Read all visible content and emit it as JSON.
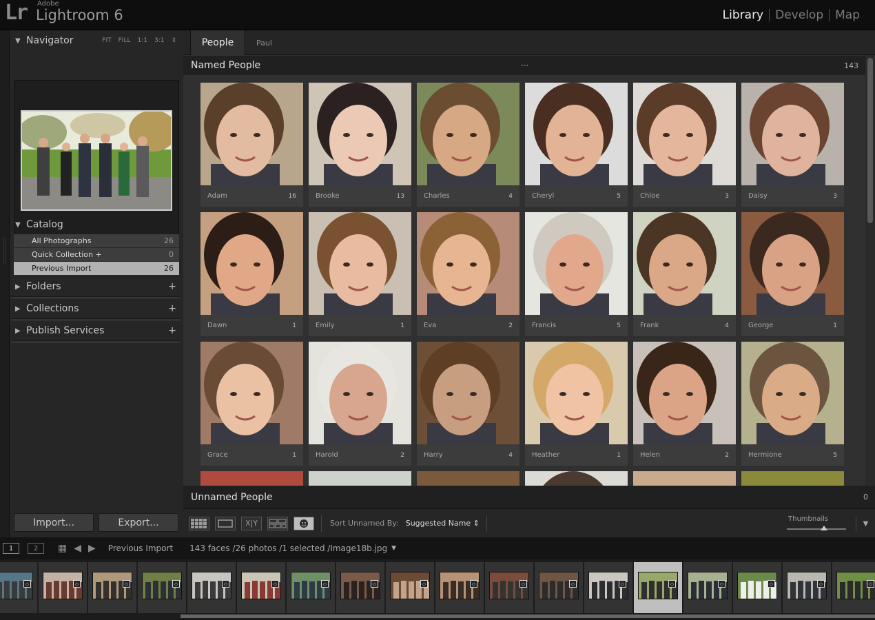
{
  "app": {
    "adobe": "Adobe",
    "name": "Lightroom 6",
    "logo": "Lr"
  },
  "modules": [
    {
      "label": "Library",
      "active": true
    },
    {
      "label": "Develop",
      "active": false
    },
    {
      "label": "Map",
      "active": false
    }
  ],
  "navigator": {
    "title": "Navigator",
    "options": [
      "FIT",
      "FILL",
      "1:1",
      "3:1"
    ],
    "options_caret": "⇕"
  },
  "catalog": {
    "title": "Catalog",
    "items": [
      {
        "label": "All Photographs",
        "count": "26"
      },
      {
        "label": "Quick Collection +",
        "count": "0"
      },
      {
        "label": "Previous Import",
        "count": "26"
      }
    ]
  },
  "panels": [
    {
      "label": "Folders"
    },
    {
      "label": "Collections"
    },
    {
      "label": "Publish Services"
    }
  ],
  "buttons": {
    "import": "Import...",
    "export": "Export..."
  },
  "tabs": {
    "people": "People",
    "paul": "Paul"
  },
  "named": {
    "title": "Named People",
    "dots": "···",
    "count": "143"
  },
  "unnamed": {
    "title": "Unnamed People",
    "count": "0"
  },
  "faces": [
    {
      "name": "Adam",
      "count": "16",
      "bg": "#b7a68c",
      "skin": "#e3bba0",
      "hair": "#5a3f2a"
    },
    {
      "name": "Brooke",
      "count": "13",
      "bg": "#cfc5b6",
      "skin": "#ecc9b4",
      "hair": "#2a2120"
    },
    {
      "name": "Charles",
      "count": "4",
      "bg": "#7c8a5a",
      "skin": "#d6a883",
      "hair": "#6b4d31"
    },
    {
      "name": "Cheryl",
      "count": "5",
      "bg": "#dcdcdc",
      "skin": "#e2b394",
      "hair": "#4a2e22"
    },
    {
      "name": "Chloe",
      "count": "3",
      "bg": "#dedbd6",
      "skin": "#e4b79c",
      "hair": "#5a3c28"
    },
    {
      "name": "Daisy",
      "count": "3",
      "bg": "#b9b2aa",
      "skin": "#e0b39e",
      "hair": "#6a4430"
    },
    {
      "name": "Dawn",
      "count": "1",
      "bg": "#c4a080",
      "skin": "#e0a887",
      "hair": "#2c1d17"
    },
    {
      "name": "Emily",
      "count": "1",
      "bg": "#c9c0b3",
      "skin": "#e9bca1",
      "hair": "#7a5232"
    },
    {
      "name": "Eva",
      "count": "2",
      "bg": "#b68b77",
      "skin": "#e8b592",
      "hair": "#8b6236"
    },
    {
      "name": "Francis",
      "count": "5",
      "bg": "#e6e6e0",
      "skin": "#e1a88c",
      "hair": "#cfc9c0"
    },
    {
      "name": "Frank",
      "count": "4",
      "bg": "#cfd3c2",
      "skin": "#dba887",
      "hair": "#4b3524"
    },
    {
      "name": "George",
      "count": "1",
      "bg": "#8a5b3f",
      "skin": "#d9a284",
      "hair": "#3b281e"
    },
    {
      "name": "Grace",
      "count": "1",
      "bg": "#9f7a66",
      "skin": "#ebc1a3",
      "hair": "#6a4b36"
    },
    {
      "name": "Harold",
      "count": "2",
      "bg": "#e5e3dd",
      "skin": "#d8a58e",
      "hair": "#e8e6e0"
    },
    {
      "name": "Harry",
      "count": "4",
      "bg": "#6d4f37",
      "skin": "#c79e80",
      "hair": "#5e3f25"
    },
    {
      "name": "Heather",
      "count": "1",
      "bg": "#d9c9ad",
      "skin": "#efc3a3",
      "hair": "#d3a868"
    },
    {
      "name": "Helen",
      "count": "2",
      "bg": "#c8c1b9",
      "skin": "#dba487",
      "hair": "#3a2619"
    },
    {
      "name": "Hermione",
      "count": "5",
      "bg": "#b5b18f",
      "skin": "#d9ac87",
      "hair": "#6b5540"
    },
    {
      "name": "",
      "count": "",
      "bg": "#b04a3e",
      "skin": "#d08c70",
      "hair": "#b04a3e"
    },
    {
      "name": "",
      "count": "",
      "bg": "#cdd2cc",
      "skin": "#e0b090",
      "hair": "#cdd2cc"
    },
    {
      "name": "",
      "count": "",
      "bg": "#7a5a3a",
      "skin": "#cc9a70",
      "hair": "#7a5a3a"
    },
    {
      "name": "",
      "count": "",
      "bg": "#dcdad4",
      "skin": "#d8a888",
      "hair": "#4a3a30"
    },
    {
      "name": "",
      "count": "",
      "bg": "#c9aa8a",
      "skin": "#d6a080",
      "hair": "#c9aa8a"
    },
    {
      "name": "",
      "count": "",
      "bg": "#8a8a3a",
      "skin": "#c9a070",
      "hair": "#8a8a3a"
    }
  ],
  "toolbar": {
    "sort_label": "Sort Unnamed By:",
    "sort_value": "Suggested Name ⇕",
    "thumbnails_label": "Thumbnails",
    "thumbnail_size": 0.63
  },
  "filmstrip_header": {
    "screen1": "1",
    "screen2": "2",
    "source": "Previous Import",
    "status": "143 faces /26 photos /1 selected /Image18b.jpg"
  },
  "filmstrip": [
    {
      "c1": "#557788",
      "c2": "#3a3a3a",
      "sel": false
    },
    {
      "c1": "#c2b3a6",
      "c2": "#6b3a2e",
      "sel": false
    },
    {
      "c1": "#b0987a",
      "c2": "#33302d",
      "sel": false
    },
    {
      "c1": "#6f7f46",
      "c2": "#2c2f34",
      "sel": false
    },
    {
      "c1": "#c8c6c0",
      "c2": "#3b3b3b",
      "sel": false
    },
    {
      "c1": "#c9c6b5",
      "c2": "#8a3a35",
      "sel": false
    },
    {
      "c1": "#6f8f66",
      "c2": "#2e3a44",
      "sel": false
    },
    {
      "c1": "#7a5a48",
      "c2": "#2a2220",
      "sel": false
    },
    {
      "c1": "#6b4a36",
      "c2": "#c2a38c",
      "sel": false
    },
    {
      "c1": "#b69276",
      "c2": "#3a2d26",
      "sel": false
    },
    {
      "c1": "#7a4c3c",
      "c2": "#333",
      "sel": false
    },
    {
      "c1": "#6e5544",
      "c2": "#2c2c2c",
      "sel": false
    },
    {
      "c1": "#c9c7c0",
      "c2": "#2d2d30",
      "sel": false
    },
    {
      "c1": "#97a86a",
      "c2": "#2f2f2f",
      "sel": true
    },
    {
      "c1": "#a7b08f",
      "c2": "#2a2e35",
      "sel": false
    },
    {
      "c1": "#6b8a4a",
      "c2": "#eeeeee",
      "sel": false
    },
    {
      "c1": "#b8b8b0",
      "c2": "#30333a",
      "sel": false
    },
    {
      "c1": "#6f8f46",
      "c2": "#2a2a2a",
      "sel": false
    }
  ]
}
